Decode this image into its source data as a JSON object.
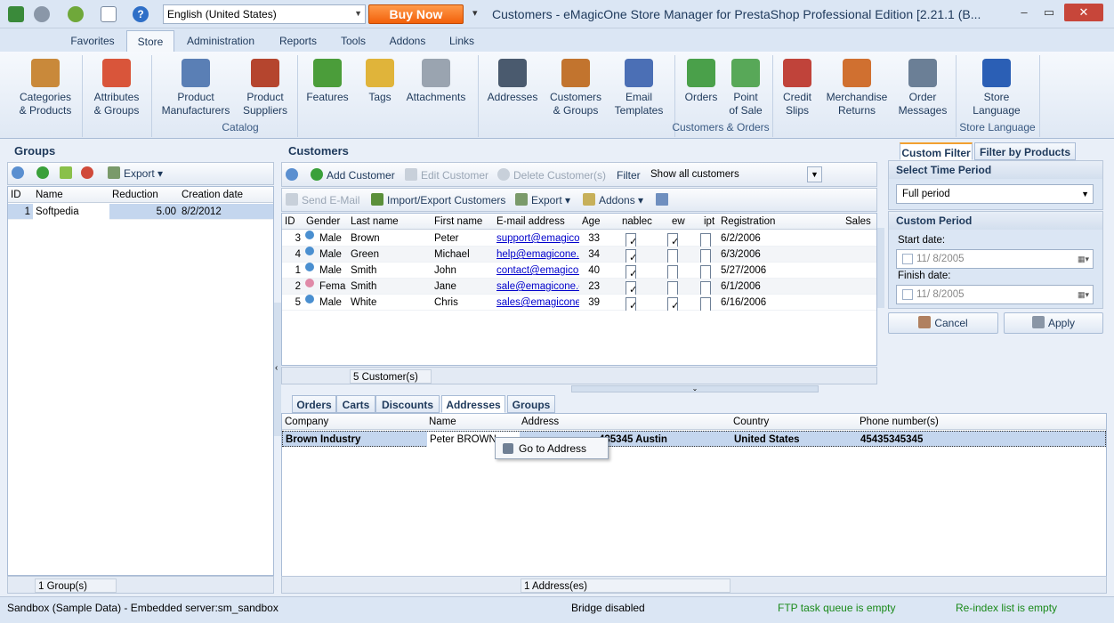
{
  "window": {
    "language": "English (United States)",
    "buy_now": "Buy Now",
    "title": "Customers - eMagicOne Store Manager for PrestaShop Professional Edition [2.21.1 (B..."
  },
  "ribbon_tabs": [
    "Favorites",
    "Store",
    "Administration",
    "Reports",
    "Tools",
    "Addons",
    "Links"
  ],
  "ribbon": {
    "buttons": [
      {
        "label": "Categories\n& Products",
        "color": "#c9893a"
      },
      {
        "label": "Attributes\n& Groups",
        "color": "#d9553a"
      },
      {
        "label": "Product\nManufacturers",
        "color": "#5a7fb5"
      },
      {
        "label": "Product\nSuppliers",
        "color": "#b5452e"
      },
      {
        "label": "Features",
        "color": "#4b9d3a"
      },
      {
        "label": "Tags",
        "color": "#e0b43a"
      },
      {
        "label": "Attachments",
        "color": "#9aa4b0"
      },
      {
        "label": "Addresses",
        "color": "#4a5a6e"
      },
      {
        "label": "Customers\n& Groups",
        "color": "#c2742e"
      },
      {
        "label": "Email\nTemplates",
        "color": "#4b6fb5"
      },
      {
        "label": "Orders",
        "color": "#4aa04a"
      },
      {
        "label": "Point\nof Sale",
        "color": "#58a858"
      },
      {
        "label": "Credit\nSlips",
        "color": "#c0433a"
      },
      {
        "label": "Merchandise\nReturns",
        "color": "#d07030"
      },
      {
        "label": "Order\nMessages",
        "color": "#6b7f96"
      },
      {
        "label": "Store\nLanguage",
        "color": "#2b5fb5"
      }
    ],
    "groups": [
      "Catalog",
      "Customers & Orders",
      "Store Language"
    ]
  },
  "groups_panel": {
    "title": "Groups",
    "export_label": "Export",
    "columns": [
      "ID",
      "Name",
      "Reduction",
      "Creation date"
    ],
    "rows": [
      {
        "id": "1",
        "name": "Softpedia",
        "reduction": "5.00",
        "created": "8/2/2012"
      }
    ],
    "footer": "1 Group(s)"
  },
  "customers_panel": {
    "title": "Customers",
    "add": "Add Customer",
    "edit": "Edit Customer",
    "delete": "Delete Customer(s)",
    "filter_label": "Filter",
    "filter_value": "Show all customers",
    "send_email": "Send E-Mail",
    "import_export": "Import/Export Customers",
    "export": "Export",
    "addons": "Addons",
    "columns": [
      "ID",
      "Gender",
      "Last name",
      "First name",
      "E-mail address",
      "Age",
      "nablec",
      "ew",
      "ipt",
      "Registration",
      "Sales"
    ],
    "rows": [
      {
        "id": "3",
        "gender": "Male",
        "last": "Brown",
        "first": "Peter",
        "email": "support@emagicor",
        "age": "33",
        "c1": true,
        "c2": true,
        "c3": false,
        "reg": "6/2/2006"
      },
      {
        "id": "4",
        "gender": "Male",
        "last": "Green",
        "first": "Michael",
        "email": "help@emagicone.c",
        "age": "34",
        "c1": true,
        "c2": false,
        "c3": false,
        "reg": "6/3/2006"
      },
      {
        "id": "1",
        "gender": "Male",
        "last": "Smith",
        "first": "John",
        "email": "contact@emagicor",
        "age": "40",
        "c1": true,
        "c2": false,
        "c3": false,
        "reg": "5/27/2006"
      },
      {
        "id": "2",
        "gender": "Fema",
        "last": "Smith",
        "first": "Jane",
        "email": "sale@emagicone.c",
        "age": "23",
        "c1": true,
        "c2": false,
        "c3": false,
        "reg": "6/1/2006"
      },
      {
        "id": "5",
        "gender": "Male",
        "last": "White",
        "first": "Chris",
        "email": "sales@emagicone.",
        "age": "39",
        "c1": true,
        "c2": true,
        "c3": false,
        "reg": "6/16/2006"
      }
    ],
    "footer": "5 Customer(s)"
  },
  "detail_tabs": [
    "Orders",
    "Carts",
    "Discounts",
    "Addresses",
    "Groups"
  ],
  "addresses": {
    "columns": [
      "Company",
      "Name",
      "Address",
      "Country",
      "Phone number(s)"
    ],
    "row": {
      "company": "Brown Industry",
      "name": "Peter BROWN",
      "address": "435345 Austin",
      "country": "United States",
      "phone": "45435345345"
    },
    "context_menu": "Go to Address",
    "footer": "1 Address(es)"
  },
  "filter_panel": {
    "tab_custom": "Custom Filter",
    "tab_products": "Filter by Products",
    "time_period_header": "Select Time Period",
    "time_period_value": "Full period",
    "custom_period_header": "Custom Period",
    "start_label": "Start date:",
    "start_value": "11/  8/2005",
    "finish_label": "Finish date:",
    "finish_value": "11/  8/2005",
    "cancel": "Cancel",
    "apply": "Apply"
  },
  "status": {
    "left": "Sandbox (Sample Data) - Embedded server:sm_sandbox",
    "bridge": "Bridge disabled",
    "ftp": "FTP task queue is empty",
    "reindex": "Re-index list is empty",
    "ftp_color": "#1a8a1a"
  }
}
